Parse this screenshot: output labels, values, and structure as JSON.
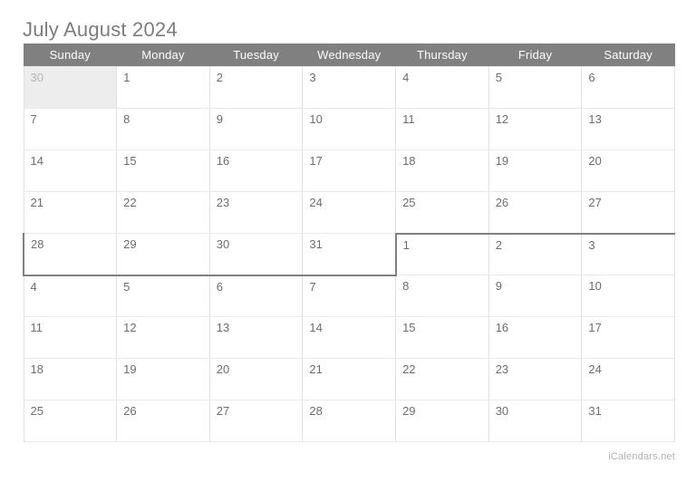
{
  "calendar": {
    "title": "July August 2024",
    "watermark": "iCalendars.net",
    "colors": {
      "header_background": "#808080",
      "header_text": "#ffffff",
      "day_text": "#6d6d6d",
      "muted_day_text": "#b4b4b4",
      "muted_cell_background": "#ededed",
      "grid_line": "#e2e2e2",
      "month_outline": "#808080",
      "title_text": "#7d7d7d",
      "watermark_text": "#b0b0b0"
    },
    "weekday_headers": [
      "Sunday",
      "Monday",
      "Tuesday",
      "Wednesday",
      "Thursday",
      "Friday",
      "Saturday"
    ],
    "weeks": [
      {
        "days": [
          {
            "label": "30",
            "muted": true
          },
          {
            "label": "1",
            "muted": false
          },
          {
            "label": "2",
            "muted": false
          },
          {
            "label": "3",
            "muted": false
          },
          {
            "label": "4",
            "muted": false
          },
          {
            "label": "5",
            "muted": false
          },
          {
            "label": "6",
            "muted": false
          }
        ]
      },
      {
        "days": [
          {
            "label": "7",
            "muted": false
          },
          {
            "label": "8",
            "muted": false
          },
          {
            "label": "9",
            "muted": false
          },
          {
            "label": "10",
            "muted": false
          },
          {
            "label": "11",
            "muted": false
          },
          {
            "label": "12",
            "muted": false
          },
          {
            "label": "13",
            "muted": false
          }
        ]
      },
      {
        "days": [
          {
            "label": "14",
            "muted": false
          },
          {
            "label": "15",
            "muted": false
          },
          {
            "label": "16",
            "muted": false
          },
          {
            "label": "17",
            "muted": false
          },
          {
            "label": "18",
            "muted": false
          },
          {
            "label": "19",
            "muted": false
          },
          {
            "label": "20",
            "muted": false
          }
        ]
      },
      {
        "days": [
          {
            "label": "21",
            "muted": false
          },
          {
            "label": "22",
            "muted": false
          },
          {
            "label": "23",
            "muted": false
          },
          {
            "label": "24",
            "muted": false
          },
          {
            "label": "25",
            "muted": false
          },
          {
            "label": "26",
            "muted": false
          },
          {
            "label": "27",
            "muted": false
          }
        ]
      },
      {
        "days": [
          {
            "label": "28",
            "muted": false
          },
          {
            "label": "29",
            "muted": false
          },
          {
            "label": "30",
            "muted": false
          },
          {
            "label": "31",
            "muted": false
          },
          {
            "label": "1",
            "muted": false
          },
          {
            "label": "2",
            "muted": false
          },
          {
            "label": "3",
            "muted": false
          }
        ]
      },
      {
        "days": [
          {
            "label": "4",
            "muted": false
          },
          {
            "label": "5",
            "muted": false
          },
          {
            "label": "6",
            "muted": false
          },
          {
            "label": "7",
            "muted": false
          },
          {
            "label": "8",
            "muted": false
          },
          {
            "label": "9",
            "muted": false
          },
          {
            "label": "10",
            "muted": false
          }
        ]
      },
      {
        "days": [
          {
            "label": "11",
            "muted": false
          },
          {
            "label": "12",
            "muted": false
          },
          {
            "label": "13",
            "muted": false
          },
          {
            "label": "14",
            "muted": false
          },
          {
            "label": "15",
            "muted": false
          },
          {
            "label": "16",
            "muted": false
          },
          {
            "label": "17",
            "muted": false
          }
        ]
      },
      {
        "days": [
          {
            "label": "18",
            "muted": false
          },
          {
            "label": "19",
            "muted": false
          },
          {
            "label": "20",
            "muted": false
          },
          {
            "label": "21",
            "muted": false
          },
          {
            "label": "22",
            "muted": false
          },
          {
            "label": "23",
            "muted": false
          },
          {
            "label": "24",
            "muted": false
          }
        ]
      },
      {
        "days": [
          {
            "label": "25",
            "muted": false
          },
          {
            "label": "26",
            "muted": false
          },
          {
            "label": "27",
            "muted": false
          },
          {
            "label": "28",
            "muted": false
          },
          {
            "label": "29",
            "muted": false
          },
          {
            "label": "30",
            "muted": false
          },
          {
            "label": "31",
            "muted": false
          }
        ]
      }
    ],
    "month_boundary": {
      "transition_week_index": 4,
      "last_day_column_index": 3,
      "first_day_column_index": 4
    }
  }
}
